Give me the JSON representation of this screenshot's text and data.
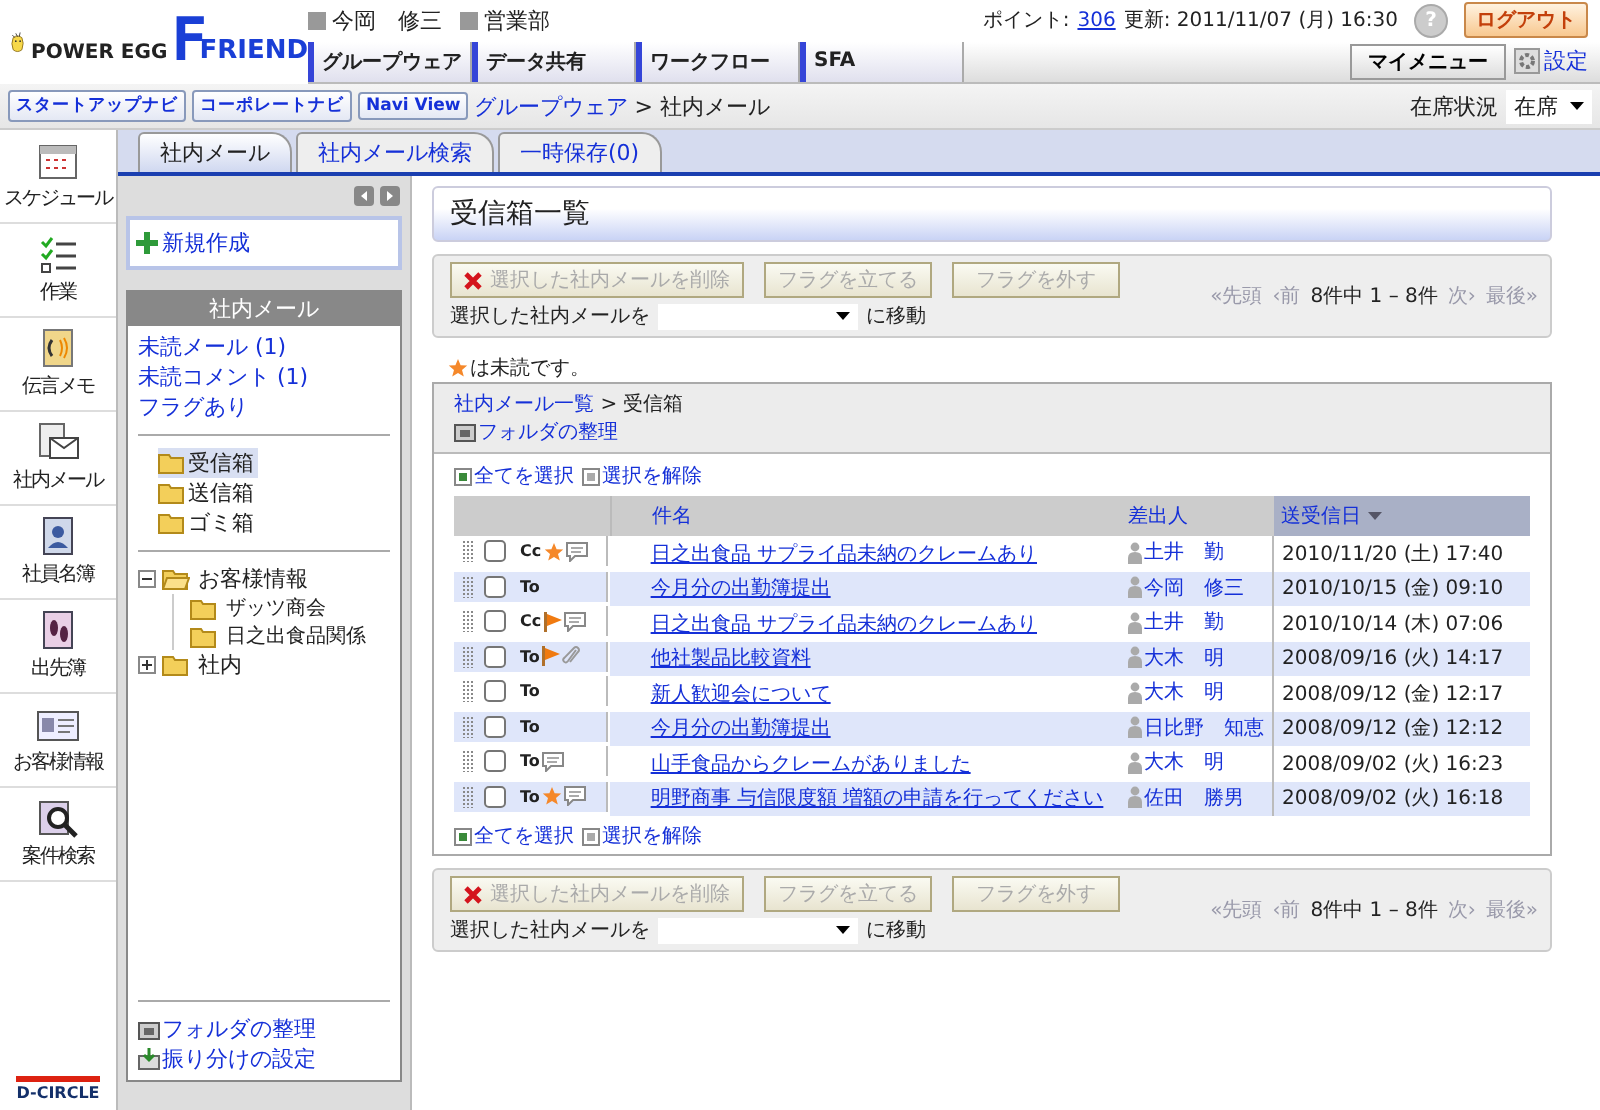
{
  "header": {
    "brand": "POWER EGG",
    "product_mark": "F",
    "product_name": "FRIEND",
    "user": "今岡　修三",
    "department": "営業部",
    "points_label": "ポイント:",
    "points": "306",
    "updated": "更新: 2011/11/07 (月) 16:30",
    "help": "?",
    "logout": "ログアウト"
  },
  "nav_tabs": [
    "グループウェア",
    "データ共有",
    "ワークフロー",
    "SFA"
  ],
  "my_menu": "マイメニュー",
  "settings": "設定",
  "navi_buttons": [
    "スタートアップナビ",
    "コーポレートナビ",
    "Navi View"
  ],
  "breadcrumb": {
    "link": "グループウェア",
    "current": "> 社内メール"
  },
  "presence": {
    "label": "在席状況",
    "value": "在席"
  },
  "rail": [
    {
      "label": "スケジュール",
      "kind": "calendar"
    },
    {
      "label": "作業",
      "kind": "tasks"
    },
    {
      "label": "伝言メモ",
      "kind": "memo"
    },
    {
      "label": "社内メール",
      "kind": "mail"
    },
    {
      "label": "社員名簿",
      "kind": "directory"
    },
    {
      "label": "出先簿",
      "kind": "footprints"
    },
    {
      "label": "お客様情報",
      "kind": "card"
    },
    {
      "label": "案件検索",
      "kind": "search"
    }
  ],
  "footer_logo": "D-CIRCLE",
  "tabs": [
    {
      "label": "社内メール",
      "selected": true
    },
    {
      "label": "社内メール検索",
      "selected": false
    },
    {
      "label": "一時保存(0)",
      "selected": false
    }
  ],
  "sidebar": {
    "new_button": "新規作成",
    "box_title": "社内メール",
    "quick_links": [
      "未読メール (1)",
      "未読コメント (1)",
      "フラグあり"
    ],
    "folders": [
      {
        "label": "受信箱",
        "selected": true
      },
      {
        "label": "送信箱",
        "selected": false
      },
      {
        "label": "ゴミ箱",
        "selected": false
      }
    ],
    "tree": [
      {
        "label": "お客様情報",
        "expanded": true,
        "children": [
          {
            "label": "ザッツ商会"
          },
          {
            "label": "日之出食品関係"
          }
        ]
      },
      {
        "label": "社内",
        "expanded": false
      }
    ],
    "footer_links": [
      {
        "label": "フォルダの整理",
        "kind": "organize"
      },
      {
        "label": "振り分けの設定",
        "kind": "sort"
      }
    ]
  },
  "page_title": "受信箱一覧",
  "toolbar_top": {
    "buttons": [
      {
        "label": "選択した社内メールを削除",
        "kind": "delete",
        "disabled": true
      },
      {
        "label": "フラグを立てる",
        "kind": "plain",
        "disabled": true
      },
      {
        "label": "フラグを外す",
        "kind": "plain",
        "disabled": true
      }
    ],
    "move_label": "選択した社内メールを",
    "move_suffix": "に移動",
    "pager": [
      {
        "label": "«先頭",
        "kind": "link",
        "disabled": true
      },
      {
        "label": "‹前",
        "kind": "link",
        "disabled": true
      },
      {
        "label": "8件中 1 – 8件",
        "kind": "count"
      },
      {
        "label": "次›",
        "kind": "link",
        "disabled": true
      },
      {
        "label": "最後»",
        "kind": "link",
        "disabled": true
      }
    ]
  },
  "legend": "は未読です。",
  "panel": {
    "path_link": "社内メール一覧",
    "path_current": "> 受信箱",
    "organize": "フォルダの整理"
  },
  "select_top": [
    "全てを選択",
    "選択を解除"
  ],
  "table": {
    "columns": [
      {
        "label": "件名"
      },
      {
        "label": "差出人"
      },
      {
        "label": "送受信日",
        "sorted": true
      }
    ],
    "rows": [
      {
        "checked": false,
        "recipient": "Cc",
        "unread": true,
        "flagged": false,
        "comment": true,
        "attachment": false,
        "subject": "日之出食品 サプライ品未納のクレームあり",
        "sender": "土井　勤",
        "date": "2010/11/20 (土) 17:40"
      },
      {
        "checked": false,
        "recipient": "To",
        "unread": false,
        "flagged": false,
        "comment": false,
        "attachment": false,
        "subject": "今月分の出勤簿提出",
        "sender": "今岡　修三",
        "date": "2010/10/15 (金) 09:10"
      },
      {
        "checked": false,
        "recipient": "Cc",
        "unread": false,
        "flagged": true,
        "comment": true,
        "attachment": false,
        "subject": "日之出食品 サプライ品未納のクレームあり",
        "sender": "土井　勤",
        "date": "2010/10/14 (木) 07:06"
      },
      {
        "checked": false,
        "recipient": "To",
        "unread": false,
        "flagged": true,
        "comment": false,
        "attachment": true,
        "subject": "他社製品比較資料",
        "sender": "大木　明",
        "date": "2008/09/16 (火) 14:17"
      },
      {
        "checked": false,
        "recipient": "To",
        "unread": false,
        "flagged": false,
        "comment": false,
        "attachment": false,
        "subject": "新人歓迎会について",
        "sender": "大木　明",
        "date": "2008/09/12 (金) 12:17"
      },
      {
        "checked": false,
        "recipient": "To",
        "unread": false,
        "flagged": false,
        "comment": false,
        "attachment": false,
        "subject": "今月分の出勤簿提出",
        "sender": "日比野　知恵",
        "date": "2008/09/12 (金) 12:12"
      },
      {
        "checked": false,
        "recipient": "To",
        "unread": false,
        "flagged": false,
        "comment": true,
        "attachment": false,
        "subject": "山手食品からクレームがありました",
        "sender": "大木　明",
        "date": "2008/09/02 (火) 16:23"
      },
      {
        "checked": false,
        "recipient": "To",
        "unread": true,
        "flagged": false,
        "comment": true,
        "attachment": false,
        "subject": "明野商事 与信限度額 増額の申請を行ってください",
        "sender": "佐田　勝男",
        "date": "2008/09/02 (火) 16:18"
      }
    ]
  },
  "select_bottom": [
    "全てを選択",
    "選択を解除"
  ],
  "toolbar_bottom": {
    "buttons": [
      {
        "label": "選択した社内メールを削除",
        "kind": "delete",
        "disabled": true
      },
      {
        "label": "フラグを立てる",
        "kind": "plain",
        "disabled": true
      },
      {
        "label": "フラグを外す",
        "kind": "plain",
        "disabled": true
      }
    ],
    "move_label": "選択した社内メールを",
    "move_suffix": "に移動",
    "pager": [
      {
        "label": "«先頭",
        "kind": "link",
        "disabled": true
      },
      {
        "label": "‹前",
        "kind": "link",
        "disabled": true
      },
      {
        "label": "8件中 1 – 8件",
        "kind": "count"
      },
      {
        "label": "次›",
        "kind": "link",
        "disabled": true
      },
      {
        "label": "最後»",
        "kind": "link",
        "disabled": true
      }
    ]
  }
}
